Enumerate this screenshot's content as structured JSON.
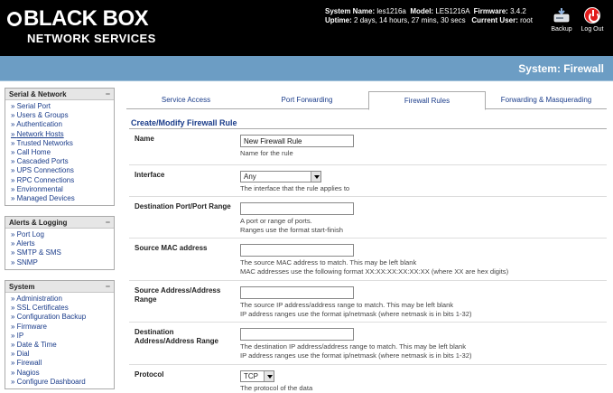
{
  "header": {
    "logo_text": "BLACK BOX",
    "logo_sub": "NETWORK SERVICES",
    "system_name_label": "System Name:",
    "system_name": "les1216a",
    "model_label": "Model:",
    "model": "LES1216A",
    "firmware_label": "Firmware:",
    "firmware": "3.4.2",
    "uptime_label": "Uptime:",
    "uptime": "2 days, 14 hours, 27 mins, 30 secs",
    "user_label": "Current User:",
    "user": "root",
    "backup_label": "Backup",
    "logout_label": "Log Out"
  },
  "page_title": "System: Firewall",
  "sidebar": {
    "serial_networking": {
      "title": "Serial & Network",
      "items": [
        "Serial Port",
        "Users & Groups",
        "Authentication",
        "Network Hosts",
        "Trusted Networks",
        "Call Home",
        "Cascaded Ports",
        "UPS Connections",
        "RPC Connections",
        "Environmental",
        "Managed Devices"
      ]
    },
    "alerts_logging": {
      "title": "Alerts & Logging",
      "items": [
        "Port Log",
        "Alerts",
        "SMTP & SMS",
        "SNMP"
      ]
    },
    "system": {
      "title": "System",
      "items": [
        "Administration",
        "SSL Certificates",
        "Configuration Backup",
        "Firmware",
        "IP",
        "Date & Time",
        "Dial",
        "Firewall",
        "Nagios",
        "Configure Dashboard"
      ]
    }
  },
  "tabs": [
    "Service Access",
    "Port Forwarding",
    "Firewall Rules",
    "Forwarding & Masquerading"
  ],
  "active_tab": "Firewall Rules",
  "form": {
    "title": "Create/Modify Firewall Rule",
    "name": {
      "label": "Name",
      "value": "New Firewall Rule",
      "help": "Name for the rule"
    },
    "interface": {
      "label": "Interface",
      "value": "Any",
      "help": "The interface that the rule applies to"
    },
    "dest_port": {
      "label": "Destination Port/Port Range",
      "value": "",
      "help1": "A port or range of ports.",
      "help2": "Ranges use the format start-finish"
    },
    "source_mac": {
      "label": "Source MAC address",
      "value": "",
      "help1": "The source MAC address to match. This may be left blank",
      "help2": "MAC addresses use the following format XX:XX:XX:XX:XX:XX (where XX are hex digits)"
    },
    "source_addr": {
      "label": "Source Address/Address Range",
      "value": "",
      "help1": "The source IP address/address range to match. This may be left blank",
      "help2": "IP address ranges use the format ip/netmask (where netmask is in bits 1-32)"
    },
    "dest_addr": {
      "label": "Destination Address/Address Range",
      "value": "",
      "help1": "The destination IP address/address range to match. This may be left blank",
      "help2": "IP address ranges use the format ip/netmask (where netmask is in bits 1-32)"
    },
    "protocol": {
      "label": "Protocol",
      "value": "TCP",
      "help": "The protocol of the data"
    }
  },
  "colors": {
    "header_bg": "#000000",
    "title_bar": "#6c9dc4",
    "link": "#1a3c8a",
    "logout_red": "#e21c1c"
  }
}
